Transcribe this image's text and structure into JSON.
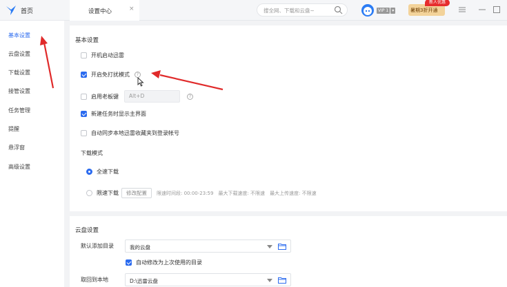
{
  "titlebar": {
    "home_label": "首页",
    "tab_label": "设置中心",
    "tab_close": "×",
    "search_placeholder": "搜全网、下载和云盘~",
    "vip_label": "VIP 1",
    "promo_text": "暑期3折开通",
    "promo_badge": "新人优惠"
  },
  "sidebar": {
    "items": [
      {
        "label": "基本设置",
        "active": true
      },
      {
        "label": "云盘设置"
      },
      {
        "label": "下载设置"
      },
      {
        "label": "接管设置"
      },
      {
        "label": "任务管理"
      },
      {
        "label": "提醒"
      },
      {
        "label": "悬浮窗"
      },
      {
        "label": "高级设置"
      }
    ]
  },
  "basic": {
    "title": "基本设置",
    "opt_autostart": "开机启动迅雷",
    "opt_nodisturb": "开启免打扰模式",
    "opt_bosskey": "启用老板键",
    "bosskey_value": "Alt+D",
    "opt_show_main": "新建任务时显示主界面",
    "opt_sync_fav": "自动同步本地迅雷收藏夹到登录帐号",
    "download_mode_title": "下载模式",
    "mode_full": "全速下载",
    "mode_limit": "限速下载",
    "modify_config": "修改配置",
    "limit_info": "限速时间段: 00:00-23:59",
    "max_down": "最大下载速度: 不限速",
    "max_up": "最大上传速度: 不限速"
  },
  "cloud": {
    "title": "云盘设置",
    "default_dir_label": "默认添加目录",
    "default_dir_value": "我的云盘",
    "auto_change": "自动修改为上次使用的目录",
    "fetch_label": "取回到本地",
    "fetch_value": "D:\\迅雷云盘"
  },
  "colors": {
    "accent": "#2b6bef",
    "annotation": "#e02a2a"
  }
}
